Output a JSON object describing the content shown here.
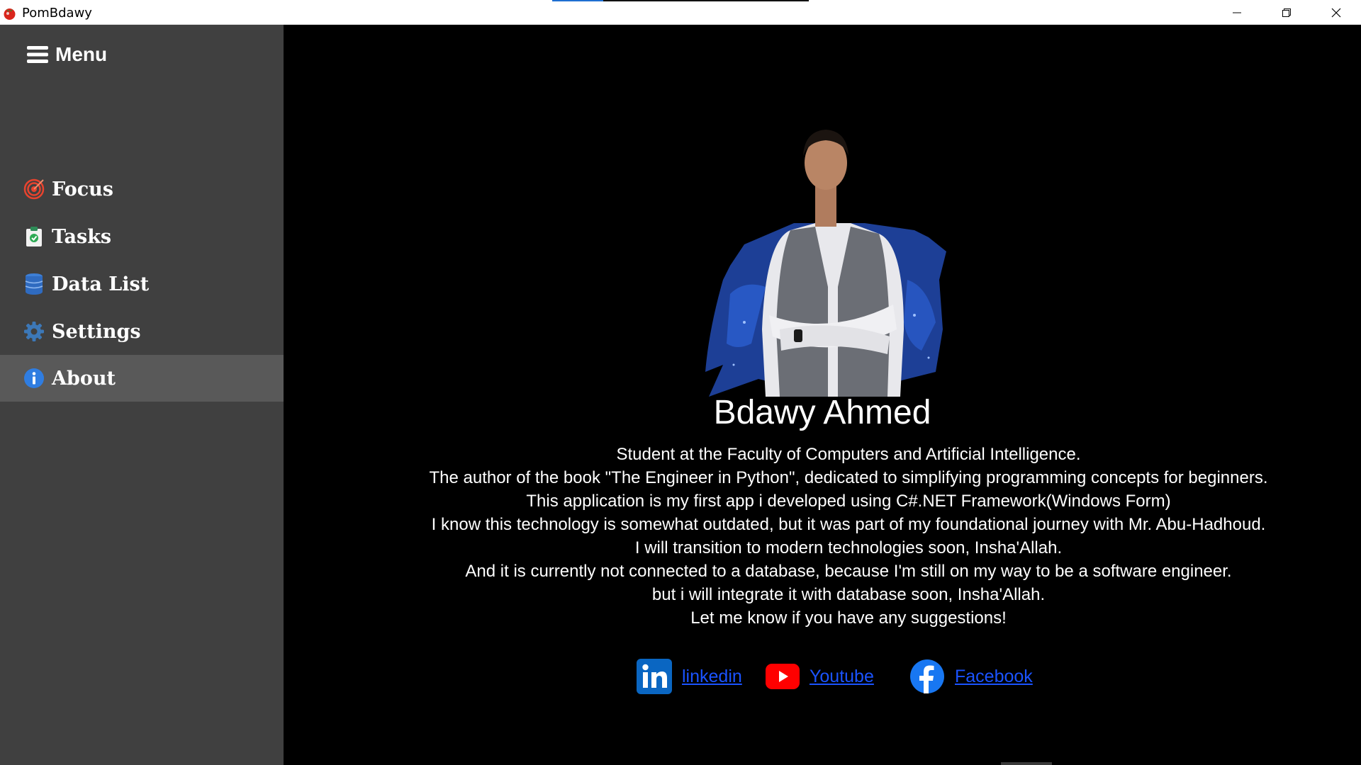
{
  "window": {
    "title": "PomBdawy",
    "minimize_icon": "minimize-icon",
    "maximize_icon": "restore-icon",
    "close_icon": "close-icon"
  },
  "sidebar": {
    "menu_label": "Menu",
    "items": [
      {
        "label": "Focus",
        "icon": "target-icon",
        "active": false
      },
      {
        "label": "Tasks",
        "icon": "clipboard-check-icon",
        "active": false
      },
      {
        "label": "Data List",
        "icon": "database-icon",
        "active": false
      },
      {
        "label": "Settings",
        "icon": "gear-icon",
        "active": false
      },
      {
        "label": "About",
        "icon": "info-icon",
        "active": true
      }
    ]
  },
  "about": {
    "name": "Bdawy Ahmed",
    "bio_lines": [
      "Student at the Faculty of Computers and Artificial Intelligence.",
      "The author of the book \"The Engineer in Python\", dedicated to simplifying programming concepts for beginners.",
      "This application is my first app i developed using C#.NET Framework(Windows Form)",
      "I know this technology is somewhat outdated, but it was part of my foundational journey with Mr. Abu-Hadhoud.",
      "I will transition to modern technologies soon, Insha'Allah.",
      "And it is currently not connected to a database, because I'm still on my way to be a software engineer.",
      "but i will integrate it with database soon, Insha'Allah.",
      "Let me know if you have any suggestions!"
    ],
    "links": [
      {
        "label": "linkedin",
        "icon": "linkedin-icon"
      },
      {
        "label": "Youtube",
        "icon": "youtube-icon"
      },
      {
        "label": "Facebook",
        "icon": "facebook-icon"
      }
    ]
  },
  "colors": {
    "sidebar_bg": "#404040",
    "sidebar_active": "#595959",
    "main_bg": "#000000",
    "link": "#1a53ff"
  }
}
